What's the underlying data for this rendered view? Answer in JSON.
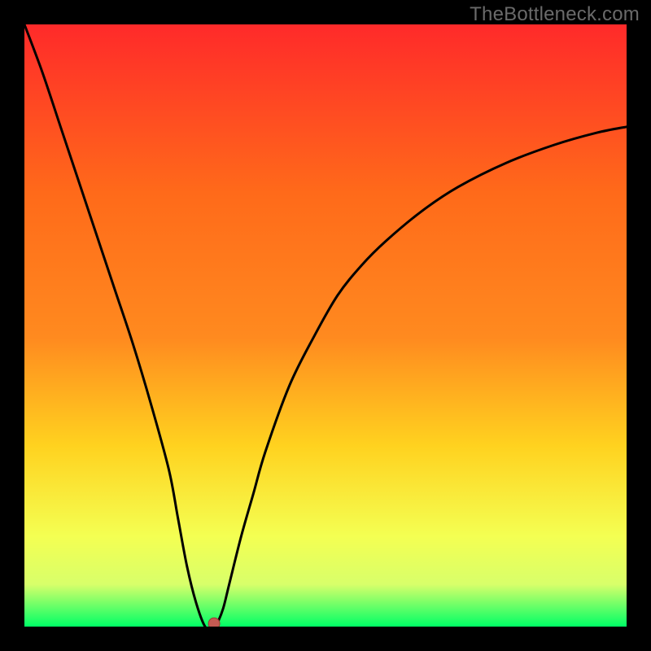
{
  "watermark": "TheBottleneck.com",
  "palette": {
    "frame": "#000000",
    "line": "#000000",
    "marker": "#c45a52",
    "gradient_top": "#ff2a2a",
    "gradient_mid_upper": "#ff8a1f",
    "gradient_mid": "#ffd21f",
    "gradient_mid_lower": "#f4ff52",
    "gradient_lower": "#d8ff6a",
    "gradient_bottom": "#00ff66"
  },
  "chart_data": {
    "type": "line",
    "title": "",
    "xlabel": "",
    "ylabel": "",
    "xlim": [
      0,
      100
    ],
    "ylim": [
      0,
      100
    ],
    "grid": false,
    "legend": false,
    "x": [
      0,
      3,
      6,
      9,
      12,
      15,
      18,
      21,
      24,
      25.5,
      27,
      28.5,
      30,
      31,
      31.5,
      32,
      33,
      34,
      36,
      38,
      40,
      44,
      48,
      52,
      56,
      60,
      66,
      72,
      80,
      88,
      95,
      100
    ],
    "values": [
      100,
      92,
      83,
      74,
      65,
      56,
      47,
      37,
      26,
      18,
      10,
      4,
      0,
      0,
      0,
      0.5,
      3,
      7,
      15,
      22,
      29,
      40,
      48,
      55,
      60,
      64,
      69,
      73,
      77,
      80,
      82,
      83
    ],
    "marker": {
      "x": 31.5,
      "y": 0.5
    },
    "notes": "V-shaped bottleneck curve with minimum near x≈31; values are percent (0=bottom/green, 100=top/red/worst)."
  }
}
